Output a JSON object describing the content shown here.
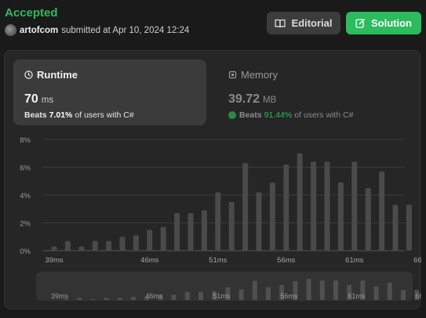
{
  "header": {
    "status": "Accepted",
    "username": "artofcom",
    "submitted_text": "submitted at Apr 10, 2024 12:24"
  },
  "buttons": {
    "editorial": "Editorial",
    "solution": "Solution"
  },
  "runtime": {
    "title": "Runtime",
    "value": "70",
    "unit": "ms",
    "beats_label": "Beats",
    "percent": "7.01%",
    "suffix": "of users with C#"
  },
  "memory": {
    "title": "Memory",
    "value": "39.72",
    "unit": "MB",
    "beats_label": "Beats",
    "percent": "91.44%",
    "suffix": "of users with C#"
  },
  "colors": {
    "accent_green": "#2cbb5d",
    "bar": "#4a4a4a",
    "highlight_bar": "#ffffff"
  },
  "chart_data": {
    "type": "bar",
    "x_unit": "ms",
    "x_start": 39,
    "x_step": 1,
    "x_tick_labels": [
      "39ms",
      "46ms",
      "51ms",
      "56ms",
      "61ms",
      "66ms"
    ],
    "y_tick_labels": [
      "8%",
      "6%",
      "4%",
      "2%",
      "0%"
    ],
    "ylim": [
      0,
      8
    ],
    "values": [
      0.3,
      0.7,
      0.3,
      0.7,
      0.7,
      1.0,
      1.1,
      1.5,
      1.7,
      2.7,
      2.7,
      2.9,
      4.2,
      3.5,
      6.3,
      4.2,
      4.9,
      6.2,
      7.0,
      6.4,
      6.4,
      4.9,
      6.4,
      4.5,
      5.7,
      3.3,
      3.3
    ],
    "highlight_x": 70,
    "highlight_value": 3.3
  }
}
